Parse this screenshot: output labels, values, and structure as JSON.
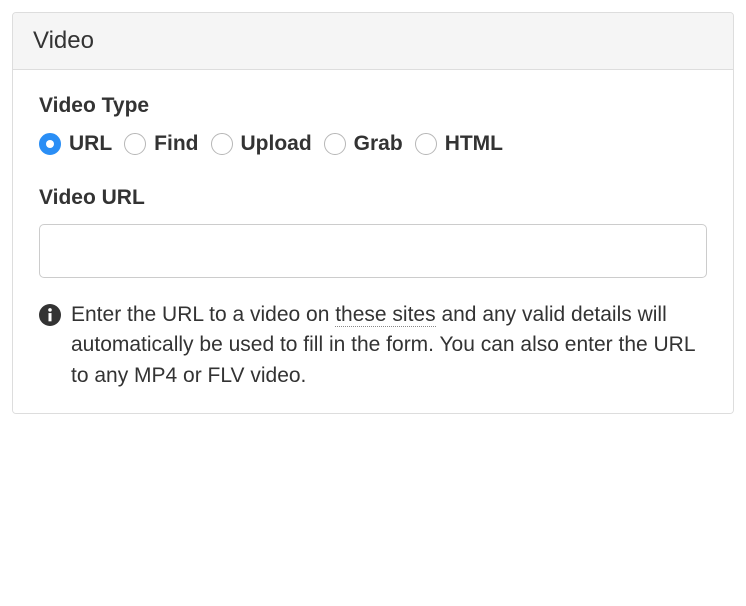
{
  "panel": {
    "title": "Video"
  },
  "videoType": {
    "label": "Video Type",
    "options": [
      {
        "value": "url",
        "label": "URL",
        "selected": true
      },
      {
        "value": "find",
        "label": "Find",
        "selected": false
      },
      {
        "value": "upload",
        "label": "Upload",
        "selected": false
      },
      {
        "value": "grab",
        "label": "Grab",
        "selected": false
      },
      {
        "value": "html",
        "label": "HTML",
        "selected": false
      }
    ]
  },
  "videoUrl": {
    "label": "Video URL",
    "value": "",
    "placeholder": ""
  },
  "help": {
    "text_before": "Enter the URL to a video on ",
    "link_text": "these sites",
    "text_after": " and any valid details will automatically be used to fill in the form. You can also enter the URL to any MP4 or FLV video."
  }
}
